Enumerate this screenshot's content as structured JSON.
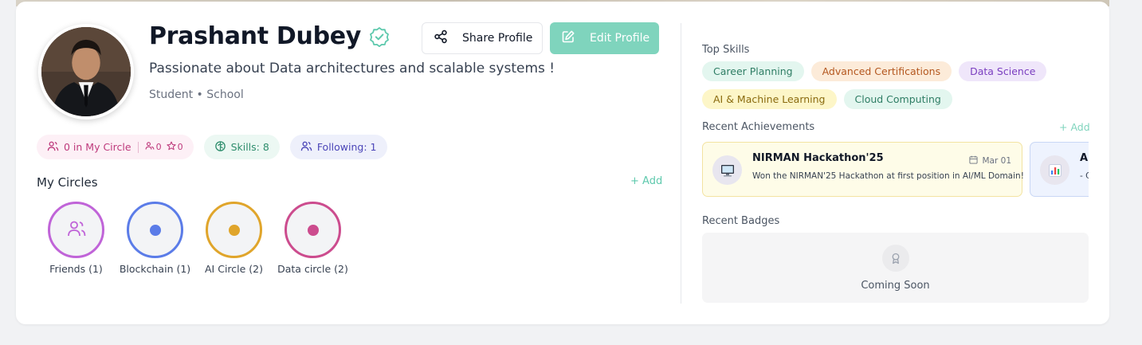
{
  "profile": {
    "name": "Prashant Dubey",
    "tagline": "Passionate about Data architectures and scalable systems !",
    "meta": "Student • School"
  },
  "actions": {
    "share_label": "Share Profile",
    "edit_label": "Edit Profile"
  },
  "stats": {
    "circle_label": "0 in My Circle",
    "members_count": "0",
    "stars_count": "0",
    "skills_label": "Skills: 8",
    "following_label": "Following: 1"
  },
  "circles": {
    "title": "My Circles",
    "add_label": "+ Add",
    "items": [
      {
        "label": "Friends (1)",
        "color": "#c064d8",
        "icon": "people-icon"
      },
      {
        "label": "Blockchain (1)",
        "color": "#5b7ce8",
        "icon": "dot"
      },
      {
        "label": "AI Circle (2)",
        "color": "#e0a52b",
        "icon": "dot"
      },
      {
        "label": "Data circle (2)",
        "color": "#cc4c8e",
        "icon": "dot"
      }
    ]
  },
  "skills": {
    "title": "Top Skills",
    "items": [
      {
        "label": "Career Planning",
        "bg": "#e3f6ef",
        "fg": "#2e7d64"
      },
      {
        "label": "Advanced Certifications",
        "bg": "#fcebd9",
        "fg": "#b4571f"
      },
      {
        "label": "Data Science",
        "bg": "#efe6fa",
        "fg": "#7b3fc0"
      },
      {
        "label": "AI & Machine Learning",
        "bg": "#fdf6c8",
        "fg": "#8a6a0e"
      },
      {
        "label": "Cloud Computing",
        "bg": "#e3f6ef",
        "fg": "#2e7d64"
      }
    ]
  },
  "achievements": {
    "title": "Recent Achievements",
    "add_label": "+ Add",
    "items": [
      {
        "title": "NIRMAN Hackathon'25",
        "date": "Mar 01",
        "description": "Won the NIRMAN'25 Hackathon at first position in AI/ML Domain!",
        "icon": "computer-icon",
        "bg": "#fefce8",
        "border": "#f3e3a2"
      },
      {
        "title": "A",
        "date": "",
        "description": "- C",
        "icon": "bar-chart-icon",
        "bg": "#eef3fe",
        "border": "#c9d7f5"
      }
    ]
  },
  "badges": {
    "title": "Recent Badges",
    "empty_label": "Coming Soon"
  },
  "colors": {
    "accent": "#7fd4bd",
    "verified": "#5ec9ad"
  }
}
